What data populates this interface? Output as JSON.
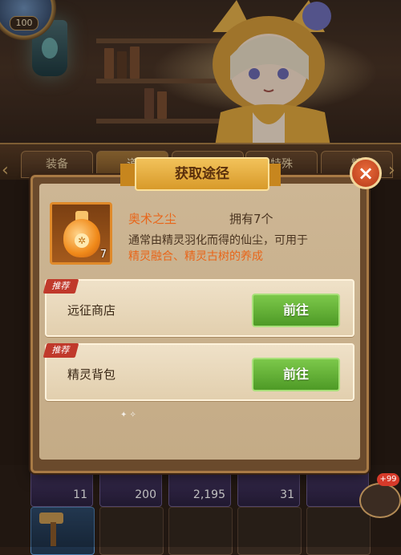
{
  "player": {
    "level": "100"
  },
  "tabs": [
    {
      "label": "装备"
    },
    {
      "label": "道"
    },
    {
      "label": ""
    },
    {
      "label": "特殊"
    },
    {
      "label": "精"
    }
  ],
  "modal": {
    "title": "获取途径",
    "close_icon": "×",
    "item": {
      "name": "奥术之尘",
      "owned": "拥有7个",
      "count": "7",
      "description_plain": "通常由精灵羽化而得的仙尘，可用于",
      "description_highlight": "精灵融合、精灵古树的养成"
    },
    "sources": [
      {
        "tag": "推荐",
        "label": "远征商店",
        "button": "前往"
      },
      {
        "tag": "推荐",
        "label": "精灵背包",
        "button": "前往"
      }
    ]
  },
  "inventory": {
    "counts": [
      "11",
      "200",
      "2,195",
      "31"
    ]
  },
  "chat": {
    "badge": "+99"
  },
  "colors": {
    "accent": "#e8661a",
    "go_button": "#5fae34",
    "close": "#c8451e"
  }
}
